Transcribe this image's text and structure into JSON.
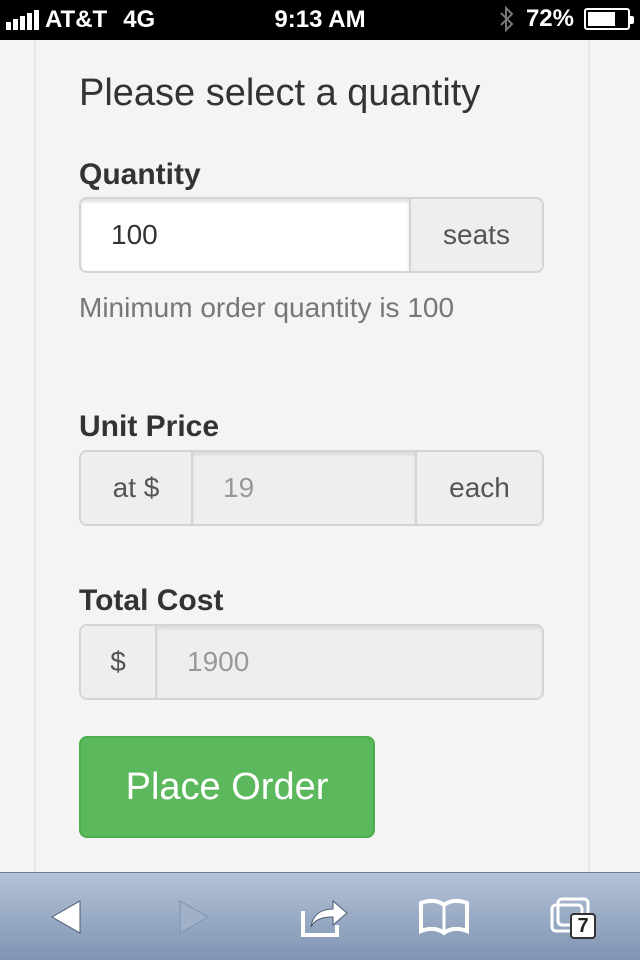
{
  "status_bar": {
    "carrier": "AT&T",
    "network": "4G",
    "time": "9:13 AM",
    "battery_percent": "72%",
    "battery_level": 0.72,
    "signal_bars": 5,
    "icons": [
      "signal-icon",
      "bluetooth-icon",
      "battery-icon"
    ]
  },
  "form": {
    "heading": "Please select a quantity",
    "quantity": {
      "label": "Quantity",
      "value": "100",
      "suffix": "seats",
      "help": "Minimum order quantity is 100"
    },
    "unit_price": {
      "label": "Unit Price",
      "prefix": "at $",
      "value": "19",
      "suffix": "each"
    },
    "total_cost": {
      "label": "Total Cost",
      "prefix": "$",
      "value": "1900"
    },
    "submit_label": "Place Order"
  },
  "toolbar": {
    "tabs_count": "7",
    "icons": [
      "back-icon",
      "forward-icon",
      "share-icon",
      "bookmarks-icon",
      "tabs-icon"
    ]
  },
  "colors": {
    "primary_button": "#5cb85c",
    "toolbar": "#8fa3c0"
  }
}
